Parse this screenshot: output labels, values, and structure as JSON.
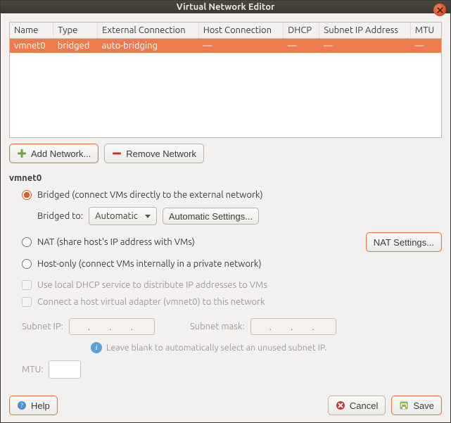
{
  "window": {
    "title": "Virtual Network Editor"
  },
  "table": {
    "columns": [
      "Name",
      "Type",
      "External Connection",
      "Host Connection",
      "DHCP",
      "Subnet IP Address",
      "MTU"
    ],
    "rows": [
      {
        "name": "vmnet0",
        "type": "bridged",
        "ext": "auto-bridging",
        "host": "—",
        "dhcp": "—",
        "subnet": "—",
        "mtu": "—"
      }
    ]
  },
  "toolbar": {
    "add_label": "Add Network...",
    "remove_label": "Remove Network"
  },
  "section_name": "vmnet0",
  "radios": {
    "bridged": "Bridged (connect VMs directly to the external network)",
    "nat": "NAT (share host's IP address with VMs)",
    "hostonly": "Host-only (connect VMs internally in a private network)"
  },
  "bridged": {
    "to_label": "Bridged to:",
    "to_value": "Automatic",
    "auto_settings": "Automatic Settings..."
  },
  "nat_settings": "NAT Settings...",
  "checks": {
    "dhcp": "Use local DHCP service to distribute IP addresses to VMs",
    "hostadapter": "Connect a host virtual adapter (vmnet0) to this network"
  },
  "subnet": {
    "ip_label": "Subnet IP:",
    "mask_label": "Subnet mask:",
    "ip_placeholder": " .   .   . ",
    "mask_placeholder": " .   .   . ",
    "hint": "Leave blank to automatically select an unused subnet IP."
  },
  "mtu_label": "MTU:",
  "footer": {
    "help": "Help",
    "cancel": "Cancel",
    "save": "Save"
  }
}
